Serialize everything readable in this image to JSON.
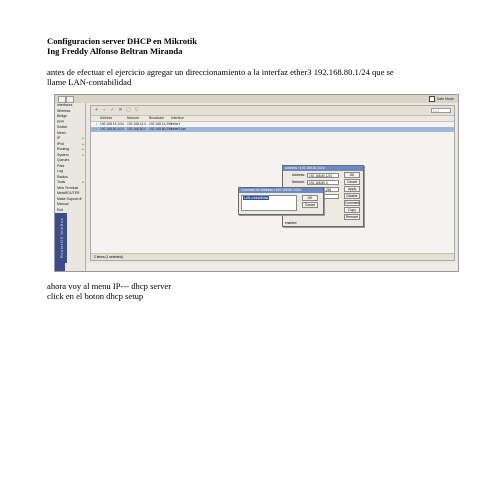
{
  "document": {
    "title_line1": "Configuracion server DHCP en Mikrotik",
    "title_line2": "Ing Freddy Alfonso Beltran Miranda",
    "paragraph1_line1": "antes de efectuar el ejercicio agregar un direccionamiento a la interfaz ether3 192.168.80.1/24 que se",
    "paragraph1_line2": "llame LAN-contabilidad",
    "paragraph2_line1": "ahora voy al menu IP--- dhcp server",
    "paragraph2_line2": "click en el boton dhcp setup"
  },
  "screenshot": {
    "safe_mode_label": "Safe Mode",
    "brand_vertical": "RouterOS WinBox",
    "sidebar_items": [
      {
        "label": "Interfaces",
        "submenu": false
      },
      {
        "label": "Wireless",
        "submenu": false
      },
      {
        "label": "Bridge",
        "submenu": false
      },
      {
        "label": "PPP",
        "submenu": false
      },
      {
        "label": "Switch",
        "submenu": false
      },
      {
        "label": "Mesh",
        "submenu": false
      },
      {
        "label": "IP",
        "submenu": true
      },
      {
        "label": "IPv6",
        "submenu": true
      },
      {
        "label": "Routing",
        "submenu": true
      },
      {
        "label": "System",
        "submenu": true
      },
      {
        "label": "Queues",
        "submenu": false
      },
      {
        "label": "Files",
        "submenu": false
      },
      {
        "label": "Log",
        "submenu": false
      },
      {
        "label": "Radius",
        "submenu": false
      },
      {
        "label": "Tools",
        "submenu": true
      },
      {
        "label": "New Terminal",
        "submenu": false
      },
      {
        "label": "MetaROUTER",
        "submenu": false
      },
      {
        "label": "Make Supout.rif",
        "submenu": false
      },
      {
        "label": "Manual",
        "submenu": false
      },
      {
        "label": "Exit",
        "submenu": false
      }
    ],
    "find_placeholder": "Find",
    "table": {
      "columns": [
        "Address",
        "Network",
        "Broadcast",
        "Interface"
      ],
      "rows": [
        {
          "flag": "",
          "address": "192.168.14.1/24",
          "network": "192.168.14.0",
          "broadcast": "192.168.14.255",
          "interface": "ether1",
          "selected": false
        },
        {
          "flag": ";;;",
          "address": "192.168.80.1/24",
          "network": "192.168.80.0",
          "broadcast": "192.168.80.255",
          "interface": "ether3-lan",
          "selected": true
        }
      ]
    },
    "status": "2 items (1 selected)",
    "address_dialog": {
      "title": "Address <192.168.80.1/24>",
      "fields": [
        {
          "label": "Address:",
          "value": "192.168.80.1/24"
        },
        {
          "label": "Network:",
          "value": "192.168.80.0"
        },
        {
          "label": "Broadcast:",
          "value": "192.168.80.255"
        },
        {
          "label": "Interface:",
          "value": "ether3-lan"
        }
      ],
      "buttons": [
        "OK",
        "Cancel",
        "Apply",
        "Disable",
        "Comment",
        "Copy",
        "Remove"
      ],
      "status": "enabled"
    },
    "comment_dialog": {
      "title": "Comment for Address <192.168.80.1/24>",
      "text": "LAN-contabilidad",
      "buttons": [
        "OK",
        "Cancel"
      ]
    }
  }
}
